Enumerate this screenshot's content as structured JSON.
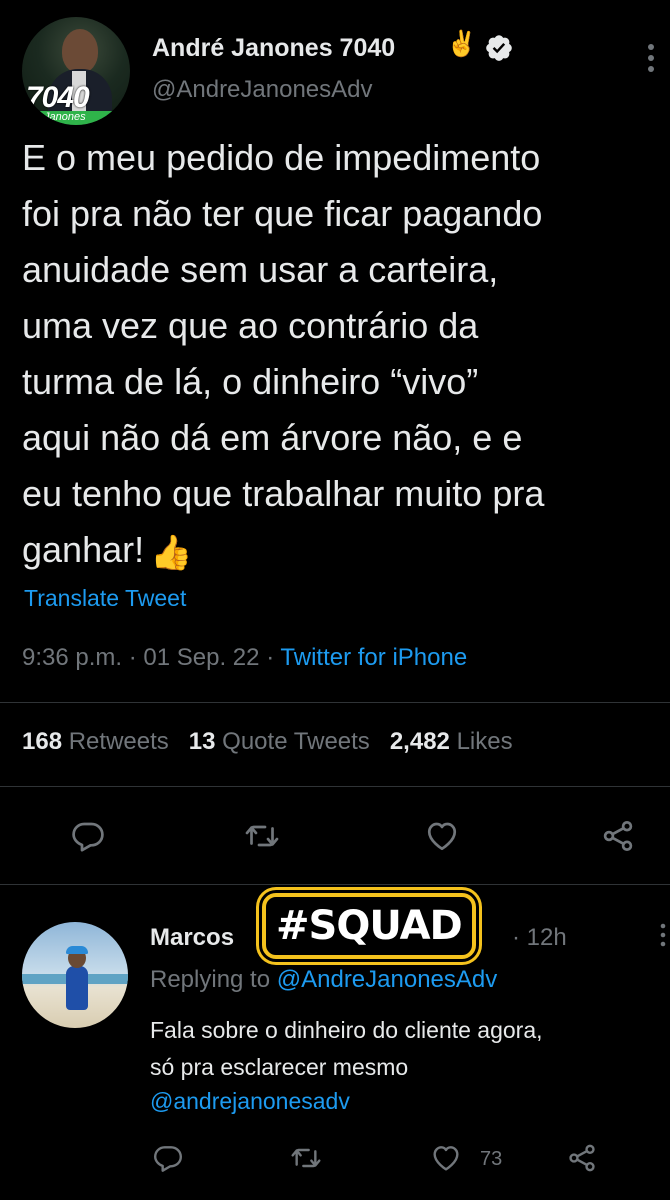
{
  "tweet": {
    "author": {
      "display_name": "André Janones 7040",
      "name_emoji": "✌️",
      "verified": true,
      "handle": "@AndreJanonesAdv",
      "avatar_badge_number": "7040",
      "avatar_badge_text": "Janones"
    },
    "text_lines": "E o meu pedido de impedimento\nfoi pra não ter que ficar pagando\nanuidade sem usar a carteira,\numa vez que ao contrário da\nturma de lá, o dinheiro “vivo”\naqui não dá em árvore não, e e\neu tenho que trabalhar muito pra\nganhar!",
    "text_emoji": "👍",
    "translate_label": "Translate Tweet",
    "time": "9:36 p.m.",
    "date": "01 Sep. 22",
    "source": "Twitter for iPhone",
    "separator": "·",
    "stats": {
      "retweets_count": "168",
      "retweets_label": "Retweets",
      "quotes_count": "13",
      "quotes_label": "Quote Tweets",
      "likes_count": "2,482",
      "likes_label": "Likes"
    },
    "actions": [
      "reply-icon",
      "retweet-icon",
      "like-icon",
      "share-icon"
    ]
  },
  "overlay": {
    "sticker_text": "#SQUAD"
  },
  "reply": {
    "display_name": "Marcos",
    "time": "· 12h",
    "replying_prefix": "Replying to",
    "replying_to": "@AndreJanonesAdv",
    "text": "Fala sobre o dinheiro do cliente agora,\nsó pra esclarecer mesmo",
    "mention": "@andrejanonesadv",
    "like_count": "73",
    "actions": [
      "reply-icon",
      "retweet-icon",
      "like-icon",
      "share-icon"
    ]
  },
  "colors": {
    "background": "#000000",
    "text": "#e7e9ea",
    "muted": "#71767b",
    "link": "#1d9bf0",
    "divider": "#2f3336",
    "sticker": "#f4c21d"
  }
}
